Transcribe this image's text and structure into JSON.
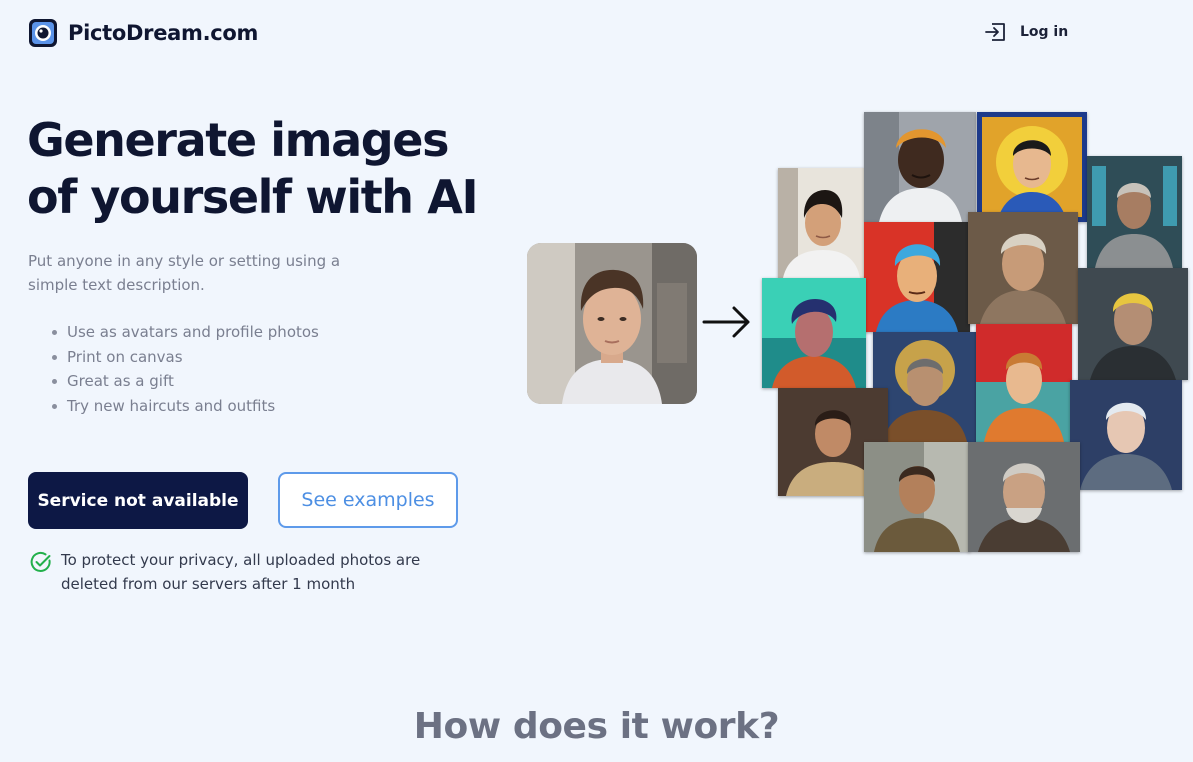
{
  "brand": {
    "name": "PictoDream.com",
    "accent": "#3b6fd6"
  },
  "nav": {
    "login_label": "Log in"
  },
  "hero": {
    "title_line1": "Generate images",
    "title_line2": "of yourself with AI",
    "subtitle": "Put anyone in any style or setting using a simple text description.",
    "features": [
      "Use as avatars and profile photos",
      "Print on canvas",
      "Great as a gift",
      "Try new haircuts and outfits"
    ],
    "primary_button": "Service not available",
    "secondary_button": "See examples",
    "privacy_note": "To protect your privacy, all uploaded photos are deleted from our servers after 1 month"
  },
  "section": {
    "how_title": "How does it work?"
  },
  "colors": {
    "background": "#f1f6fd",
    "primary_button": "#0d1845",
    "secondary_border": "#5e9aea",
    "check_icon": "#22b04b"
  },
  "icons": {
    "logo": "camera-lens-icon",
    "login": "login-arrow-icon",
    "privacy": "check-circle-icon",
    "transform": "arrow-right-icon"
  }
}
